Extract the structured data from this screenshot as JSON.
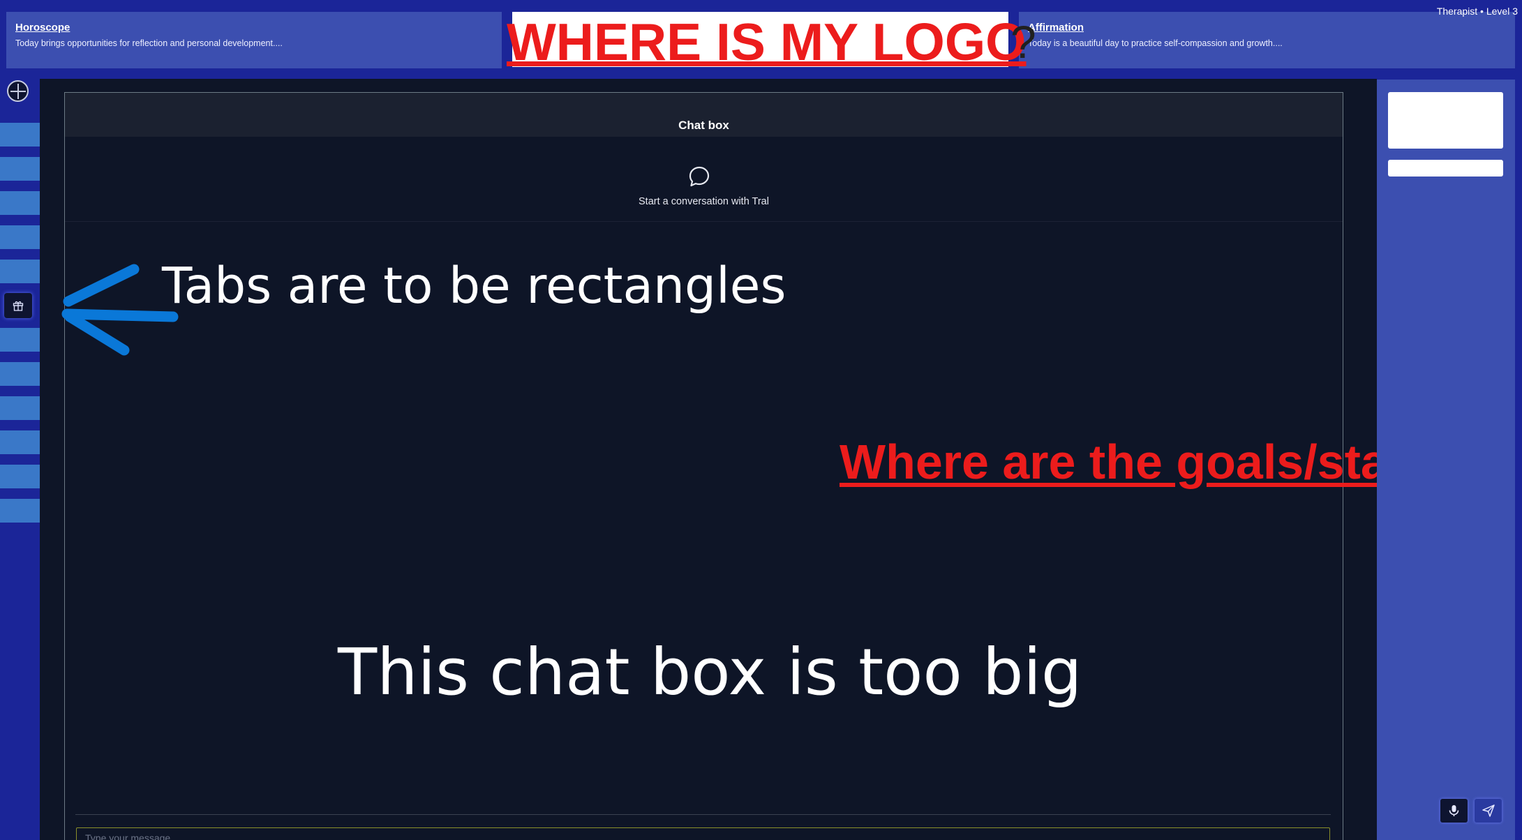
{
  "header": {
    "horoscope": {
      "title": "Horoscope",
      "text": "Today brings opportunities for reflection and personal development...."
    },
    "affirmation": {
      "title": "Affirmation",
      "text": "Today is a beautiful day to practice self-compassion and growth...."
    },
    "user_level": "Therapist • Level 3"
  },
  "annotations": {
    "logo": "WHERE IS MY LOGO",
    "logo_question": "?",
    "tabs": "Tabs are to be rectangles",
    "goals": "Where are the goals/stats?",
    "chat_size": "This chat box is too big"
  },
  "chat": {
    "title": "Chat box",
    "empty_state": "Start a conversation with Tral",
    "input_placeholder": "Type your message..."
  },
  "sidebar": {
    "logo_icon": "compass-icon",
    "tab_count": 12,
    "active_tab_icon": "gift-icon"
  },
  "right_panel": {
    "buttons": [
      "mic-icon",
      "send-icon"
    ]
  },
  "colors": {
    "frame": "#1b2598",
    "panel": "#3c4fb0",
    "chat_bg": "#0e1527",
    "tab_placeholder": "#3a78c8",
    "annotation_red": "#ec1c1c",
    "annotation_blue": "#0a78d8"
  }
}
